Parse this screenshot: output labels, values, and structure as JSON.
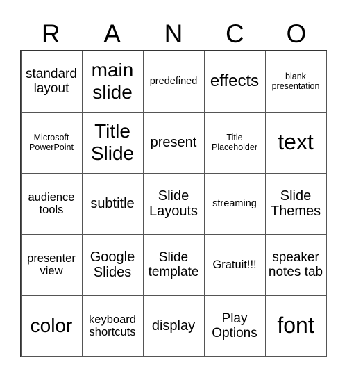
{
  "header": {
    "letters": [
      "R",
      "A",
      "N",
      "C",
      "O"
    ]
  },
  "cells": [
    "standard layout",
    "main slide",
    "predefined",
    "effects",
    "blank presentation",
    "Microsoft PowerPoint",
    "Title Slide",
    "present",
    "Title Placeholder",
    "text",
    "audience tools",
    "subtitle",
    "Slide Layouts",
    "streaming",
    "Slide Themes",
    "presenter view",
    "Google Slides",
    "Slide template",
    "Gratuit!!!",
    "speaker notes tab",
    "color",
    "keyboard shortcuts",
    "display",
    "Play Options",
    "font"
  ]
}
